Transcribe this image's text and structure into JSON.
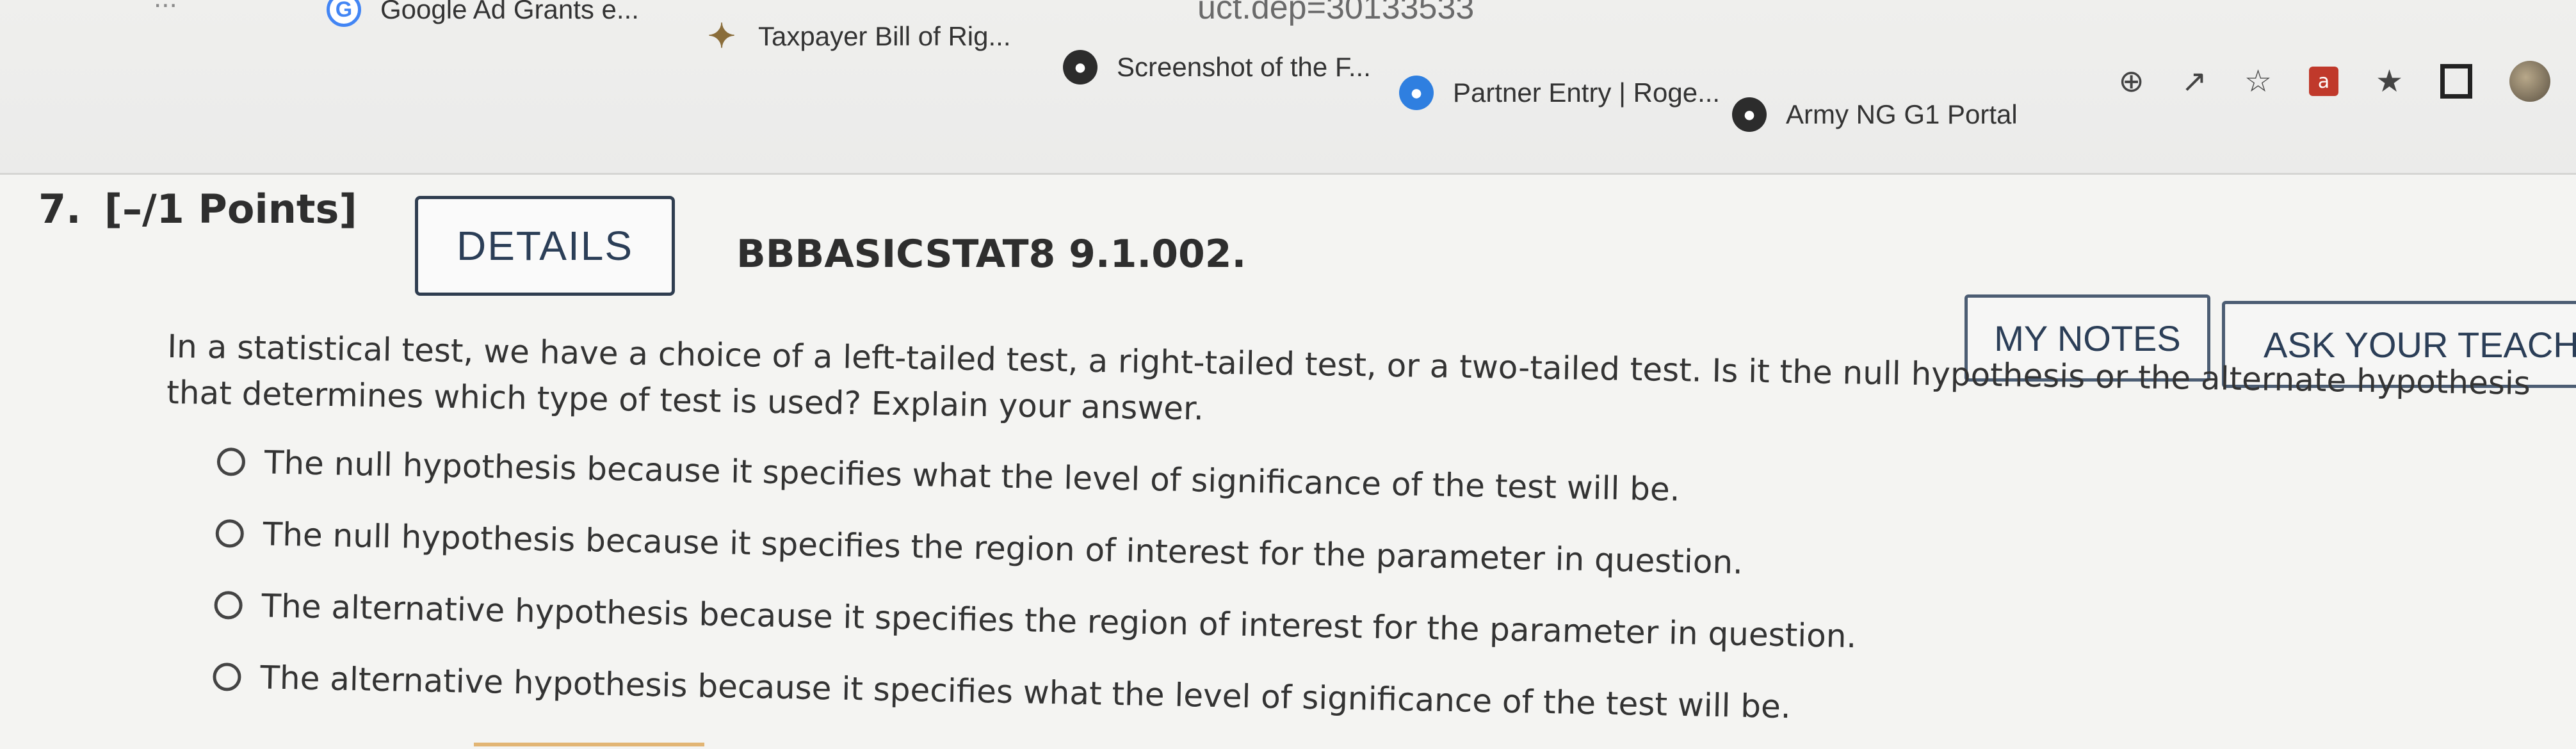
{
  "browser": {
    "url_fragment": "uct.dep=30133533",
    "left_fragment": "...",
    "bookmarks": [
      {
        "label": "Google Ad Grants e...",
        "icon": "google-icon"
      },
      {
        "label": "Taxpayer Bill of Rig...",
        "icon": "taxpayer-icon"
      },
      {
        "label": "Screenshot of the F...",
        "icon": "globe-icon"
      },
      {
        "label": "Partner Entry | Roge...",
        "icon": "partner-icon"
      },
      {
        "label": "Army NG G1 Portal",
        "icon": "globe-icon"
      }
    ],
    "toolbar_icons": [
      "zoom-icon",
      "share-icon",
      "star-icon",
      "extension-a-icon",
      "puzzle-icon",
      "window-icon",
      "profile-avatar"
    ]
  },
  "question": {
    "number": "7.",
    "points": "[–/1 Points]",
    "details_label": "DETAILS",
    "code": "BBBASICSTAT8 9.1.002.",
    "my_notes_label": "MY NOTES",
    "ask_teacher_label": "ASK YOUR TEACHER",
    "prompt": "In a statistical test, we have a choice of a left-tailed test, a right-tailed test, or a two-tailed test. Is it the null hypothesis or the alternate hypothesis that determines which type of test is used? Explain your answer.",
    "options": [
      "The null hypothesis because it specifies what the level of significance of the test will be.",
      "The null hypothesis because it specifies the region of interest for the parameter in question.",
      "The alternative hypothesis because it specifies the region of interest for the parameter in question.",
      "The alternative hypothesis because it specifies what the level of significance of the test will be."
    ]
  }
}
